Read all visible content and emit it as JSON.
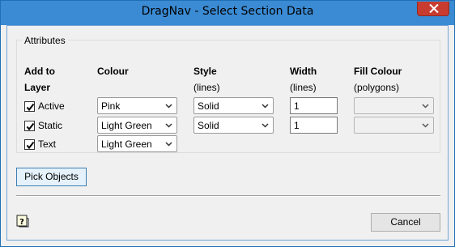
{
  "window": {
    "title": "DragNav - Select Section Data",
    "close_glyph": "close-icon"
  },
  "attributes": {
    "legend": "Attributes",
    "headers": {
      "add_to": "Add to",
      "layer": "Layer",
      "colour": "Colour",
      "style": "Style",
      "style_sub": "(lines)",
      "width": "Width",
      "width_sub": "(lines)",
      "fill_colour": "Fill Colour",
      "fill_sub": "(polygons)"
    },
    "rows": [
      {
        "layer": "Active",
        "checked": true,
        "colour": "Pink",
        "style": "Solid",
        "width": "1",
        "fill_colour": ""
      },
      {
        "layer": "Static",
        "checked": true,
        "colour": "Light Green",
        "style": "Solid",
        "width": "1",
        "fill_colour": ""
      },
      {
        "layer": "Text",
        "checked": true,
        "colour": "Light Green"
      }
    ]
  },
  "buttons": {
    "pick_objects": "Pick Objects",
    "cancel": "Cancel"
  },
  "colors": {
    "titlebar": "#3b8bd4",
    "close_button": "#c73c2f",
    "dialog_bg": "#f0f0f0"
  }
}
